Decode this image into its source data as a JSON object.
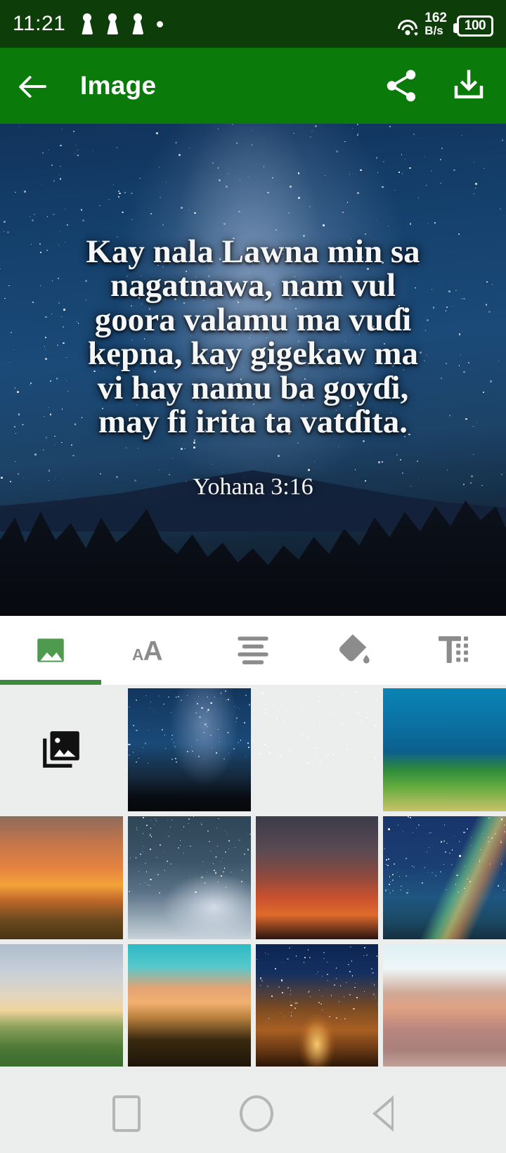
{
  "status_bar": {
    "time": "11:21",
    "notification_icons": [
      "notification-icon",
      "notification-icon",
      "notification-icon",
      "notification-dot-icon"
    ],
    "wifi_icon": "wifi-icon",
    "network_speed_value": "162",
    "network_speed_unit": "B/s",
    "battery_level": "100",
    "background_color": "#0d3d08"
  },
  "app_bar": {
    "back_label": "back-arrow",
    "title": "Image",
    "share_label": "Share",
    "download_label": "Download",
    "background_color": "#0a7a0a"
  },
  "preview": {
    "verse_lines": [
      "Kay nala Lawna min sa",
      "nagatnawa, nam vul",
      "goora valamu ma vuɗi",
      "kepna, kay gigekaw ma",
      "vi hay namu ba goyɗi,",
      "may fi irita ta vatɗita."
    ],
    "verse_text": "Kay nala Lawna min sa nagatnawa, nam vul goora valamu ma vuɗi kepna, kay gigekaw ma vi hay namu ba goyɗi, may fi irita ta vatɗita.",
    "reference": "Yohana 3:16",
    "text_color": "#f4f6f8",
    "background_description": "night-sky-milky-way-over-forest"
  },
  "tool_tabs": {
    "active_index": 0,
    "accent_color": "#3e8b3e",
    "inactive_color": "#8c8c8c",
    "items": [
      {
        "label": "Background",
        "icon": "image-icon",
        "active": true
      },
      {
        "label": "Font",
        "icon": "font-size-icon",
        "active": false
      },
      {
        "label": "Align",
        "icon": "text-align-icon",
        "active": false
      },
      {
        "label": "Color",
        "icon": "fill-color-icon",
        "active": false
      },
      {
        "label": "Text style",
        "icon": "text-format-icon",
        "active": false
      }
    ]
  },
  "gallery": {
    "picker_icon": "photo-library-icon",
    "picker_label": "Pick from gallery",
    "selected_index": 0,
    "selection_color": "#4e9a4e",
    "thumbnails": [
      {
        "name": "milky-way-over-forest",
        "selected": true,
        "style": "milkyway"
      },
      {
        "name": "starry-sky-over-road",
        "selected": false,
        "style": "road"
      },
      {
        "name": "green-hill-blue-sky",
        "selected": false,
        "style": "hill"
      },
      {
        "name": "sunset-over-field",
        "selected": false,
        "style": "field"
      },
      {
        "name": "stars-over-snow-lake",
        "selected": false,
        "style": "snow"
      },
      {
        "name": "silhouette-tree-sunset",
        "selected": false,
        "style": "tree"
      },
      {
        "name": "rainbow-over-sea",
        "selected": false,
        "style": "rainbow"
      },
      {
        "name": "sunrise-sheep-meadow",
        "selected": false,
        "style": "meadow"
      },
      {
        "name": "sunset-over-cornfield",
        "selected": false,
        "style": "corn"
      },
      {
        "name": "campfire-under-stars",
        "selected": false,
        "style": "campfire"
      },
      {
        "name": "desert-sand-dune",
        "selected": false,
        "style": "dune"
      }
    ]
  },
  "nav_bar": {
    "recents_label": "Recents",
    "home_label": "Home",
    "back_label": "Back",
    "background_color": "#eceeee"
  }
}
